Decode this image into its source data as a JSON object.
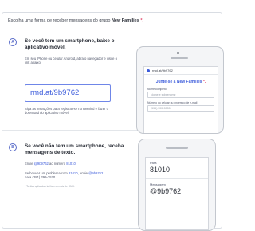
{
  "top_strip": "- - - - - - - - - - - - - - - - - - - - - - - - - - - - - - - - - - - -",
  "header": {
    "prefix": "Escolha uma forma de receber mensagens do grupo ",
    "group": "New Families",
    "star": "*."
  },
  "option_a": {
    "step": "A",
    "title": "Se você tem um smartphone, baixe o aplicativo móvel.",
    "instructions": "Em seu iPhone ou celular Android, abra o navegador e visite o link abaixo:",
    "url": "rmd.at/9b9762",
    "followup": "Siga as instruções para registrar-se no Remind e fazer o download do aplicativo móvel.",
    "phone": {
      "address": "rmd.at/9b9762",
      "join_text": "Junte-se a New Families",
      "join_star": "*.",
      "name_label": "Nome completo",
      "name_placeholder": "Nome e sobrenome",
      "contact_label": "Número do celular ou endereço de e-mail",
      "contact_placeholder": "(555) 555-5555"
    }
  },
  "option_b": {
    "step": "B",
    "title": "Se você não tem um smartphone, receba mensagens de texto.",
    "line1_prefix": "Envie ",
    "line1_code": "@9b9762",
    "line1_middle": " ao número ",
    "line1_number": "81010",
    "line1_suffix": ".",
    "line2_prefix": "Se houver um problema com ",
    "line2_number": "81010",
    "line2_middle": ", envie ",
    "line2_code": "@9b9762",
    "line2_suffix": " para (281) 299-3520.",
    "note": "* Tarifas aplicadas tarifas normais de SMS.",
    "phone": {
      "to_label": "Para",
      "to_value": "81010",
      "msg_label": "Mensagem",
      "msg_value": "@9b9762"
    }
  }
}
